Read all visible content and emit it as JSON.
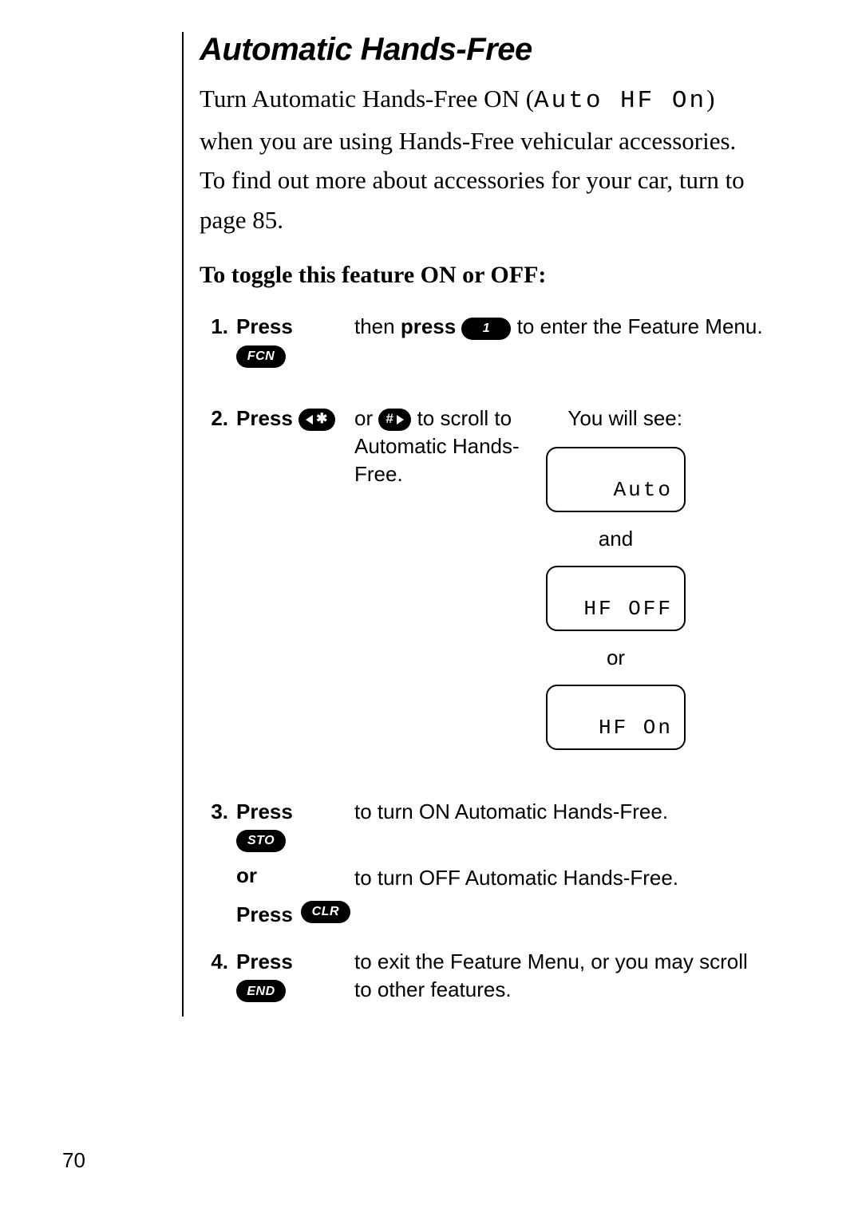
{
  "title": "Automatic Hands-Free",
  "intro": {
    "pre": "Turn Automatic Hands-Free ON (",
    "lcd": "Auto  HF  On",
    "post": ") when you are using Hands-Free vehicular accessories. To find out more about accessories for your car, turn to page 85."
  },
  "subhead": "To toggle this feature ON or OFF:",
  "keys": {
    "fcn": "FCN",
    "one": "1",
    "star": "✱",
    "hash": "#",
    "sto": "STO",
    "clr": "CLR",
    "end": "END"
  },
  "steps": {
    "s1": {
      "num": "1.",
      "press": "Press",
      "mid_then": "then",
      "mid_press": "press",
      "tail": "to enter the Feature Menu."
    },
    "s2": {
      "num": "2.",
      "press": "Press",
      "or": "or",
      "tail": "to scroll to Automatic Hands-Free.",
      "you_will_see": "You will see:",
      "lcd1": "Auto",
      "and": "and",
      "lcd2": "HF  OFF",
      "or2": "or",
      "lcd3": "HF  On"
    },
    "s3": {
      "num": "3.",
      "press": "Press",
      "or_b": "or",
      "desc_on": "to turn ON Automatic Hands-Free.",
      "desc_off": "to turn OFF Automatic Hands-Free."
    },
    "s4": {
      "num": "4.",
      "press": "Press",
      "desc": "to exit the Feature Menu, or you may scroll to other features."
    }
  },
  "page_number": "70"
}
